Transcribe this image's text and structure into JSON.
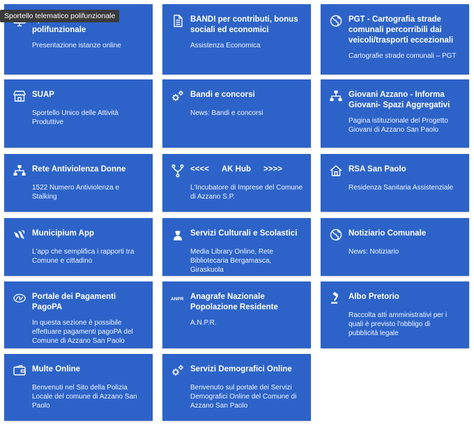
{
  "tooltip": "Sportello telematico polifunzionale",
  "cards": [
    {
      "title": "Sportello telematico polifunzionale",
      "desc": "Presentazione istanze online",
      "icon": "monitor-icon"
    },
    {
      "title": "BANDI per contributi, bonus sociali ed economici",
      "desc": "Assistenza Economica",
      "icon": "document-icon"
    },
    {
      "title": "PGT - Cartografia strade comunali percorribili dai veicoli/trasporti eccezionali",
      "desc": "Cartografie strade comunali – PGT",
      "icon": "globe-icon"
    },
    {
      "title": "SUAP",
      "desc": "Sportello Unico delle Attività Produttive",
      "icon": "shop-icon"
    },
    {
      "title": "Bandi e concorsi",
      "desc": "News: Bandi e concorsi",
      "icon": "gears-icon"
    },
    {
      "title": "Giovani Azzano - Informa Giovani- Spazi Aggregativi",
      "desc": "Pagina istituzionale del Progetto Giovani di Azzano San Paolo",
      "icon": "network-icon"
    },
    {
      "title_left": "<<<<",
      "title_mid": "AK Hub",
      "title_right": ">>>>",
      "desc": "L'Incubatore di Imprese del Comune di Azzano S.P.",
      "icon": "fork-icon"
    },
    {
      "title": "Rete Antiviolenza Donne",
      "desc": "1522 Numero Antiviolenza e Stalking",
      "icon": "network-icon"
    },
    {
      "title": "RSA San Paolo",
      "desc": "Residenza Sanitaria Assistenziale",
      "icon": "home-icon"
    },
    {
      "title": "Municipium App",
      "desc": "L'app che semplifica i rapporti tra Comune e cittadino",
      "icon": "app-logo-icon"
    },
    {
      "title": "Servizi Culturali e Scolastici",
      "desc": "Media Library Online, Rete Bibliotecaria Bergamasca, Giraskuola",
      "icon": "person-icon"
    },
    {
      "title": "Notiziario Comunale",
      "desc": "News: Notiziario",
      "icon": "globe-icon"
    },
    {
      "title": "Portale dei Pagamenti PagoPA",
      "desc": "In questa sezione è possibile effettuare pagamenti pagoPA del Comune di Azzano San Paolo",
      "icon": "pagopa-logo-icon"
    },
    {
      "title": "Anagrafe Nazionale Popolazione Residente",
      "desc": "A.N.P.R.",
      "icon": "anpr-logo-icon",
      "logo_text": "ANPR"
    },
    {
      "title": "Albo Pretorio",
      "desc": "Raccolta atti amministrativi per i quali è previsto l'obbligo di pubblicità legale",
      "icon": "gavel-icon"
    },
    {
      "title": "Multe Online",
      "desc": "Benvenuti nel Sito della Polizia Locale del comune di Azzano San Paolo",
      "icon": "wallet-icon"
    },
    {
      "title": "Servizi Demografici Online",
      "desc": "Benvenuto sul portale dei Servizi Demografici Online del Comune di Azzano San Paolo",
      "icon": "gears-icon"
    }
  ]
}
